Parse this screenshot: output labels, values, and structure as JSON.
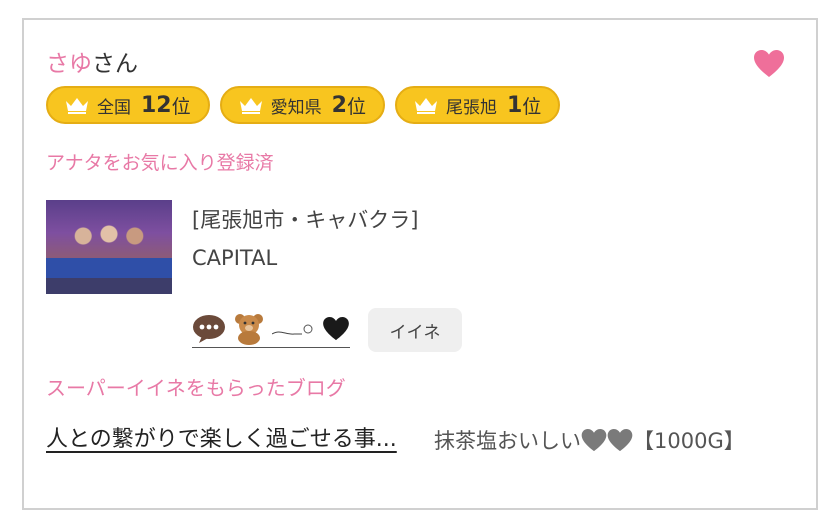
{
  "profile": {
    "name": "さゆ",
    "name_suffix": "さん"
  },
  "ranks": [
    {
      "area": "全国",
      "rank": "12",
      "suffix": "位"
    },
    {
      "area": "愛知県",
      "rank": "2",
      "suffix": "位"
    },
    {
      "area": "尾張旭",
      "rank": "1",
      "suffix": "位"
    }
  ],
  "favorite_status": "アナタをお気に入り登録済",
  "shop": {
    "area": "[尾張旭市・キャバクラ]",
    "name": "CAPITAL"
  },
  "iine_button": "イイネ",
  "super_iine_title": "スーパーイイネをもらったブログ",
  "blog": {
    "title": "人との繋がりで楽しく過ごせる事...",
    "description_prefix": "抹茶塩おいしい",
    "description_suffix": "【1000G】"
  },
  "colors": {
    "accent_pink": "#e879a6",
    "badge_yellow": "#f8c51f"
  },
  "icons": [
    "heart-icon",
    "crown-icon",
    "speech-bubble-icon",
    "bear-icon",
    "black-heart-icon",
    "gray-heart-icon"
  ]
}
